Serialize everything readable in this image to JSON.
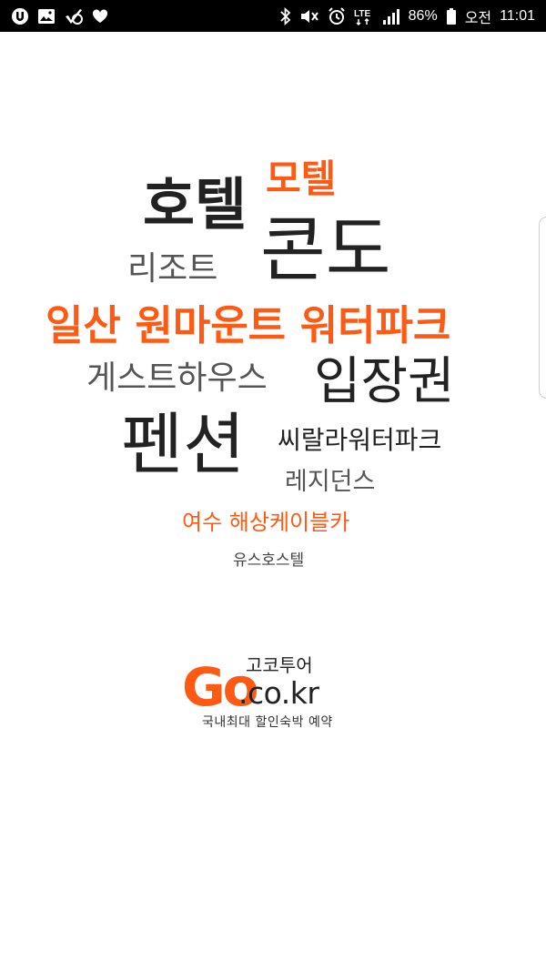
{
  "status_bar": {
    "battery_percent": "86%",
    "network": "LTE",
    "ampm": "오전",
    "time": "11:01",
    "left_icons": [
      "notification-u-icon",
      "gallery-icon",
      "vpn-check-icon",
      "heart-icon"
    ],
    "right_icons": [
      "bluetooth-icon",
      "mute-icon",
      "alarm-icon",
      "lte-icon",
      "signal-icon",
      "battery-icon"
    ]
  },
  "colors": {
    "accent": "#ff5a13",
    "dark": "#222222",
    "gray": "#555555"
  },
  "keywords": {
    "motel": "모텔",
    "hotel": "호텔",
    "condo": "콘도",
    "resort": "리조트",
    "ilsan": "일산 원마운트 워터파크",
    "guesthouse": "게스트하우스",
    "ticket": "입장권",
    "pension": "펜션",
    "seara": "씨랄라워터파크",
    "residence": "레지던스",
    "yeosu": "여수 해상케이블카",
    "hostel": "유스호스텔"
  },
  "logo": {
    "go": "Go",
    "domain": ".co.kr",
    "korean": "고코투어",
    "tagline": "국내최대 할인숙박 예약"
  }
}
